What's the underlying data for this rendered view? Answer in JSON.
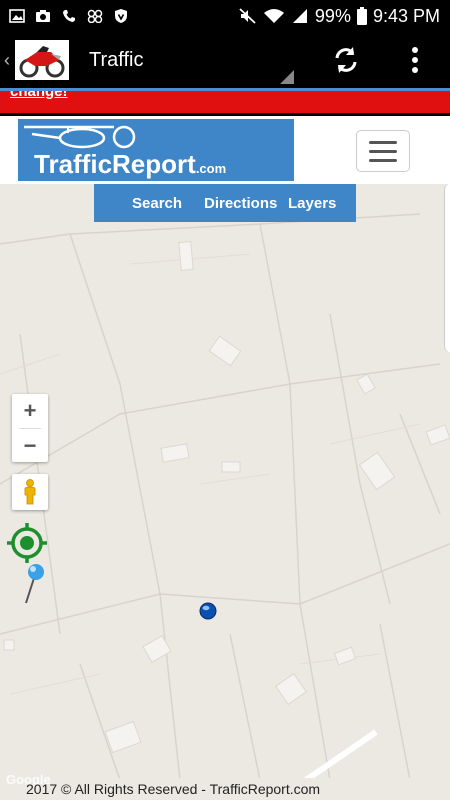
{
  "status_bar": {
    "battery": "99%",
    "time": "9:43 PM",
    "icons_left": [
      "picture-icon",
      "camera-icon",
      "phone-icon",
      "voicemail-icon",
      "shield-icon"
    ],
    "icons_right": [
      "mute-icon",
      "wifi-icon",
      "signal-icon",
      "battery-icon"
    ]
  },
  "app_bar": {
    "title": "Traffic",
    "logo_icon": "motorcycle-logo-icon",
    "actions": [
      "refresh-icon",
      "overflow-menu-icon"
    ]
  },
  "banner": {
    "link_text": "change!"
  },
  "site_header": {
    "logo_text": "TrafficReport",
    "logo_suffix": ".com"
  },
  "nav": {
    "items": [
      {
        "label": "Search"
      },
      {
        "label": "Directions"
      },
      {
        "label": "Layers"
      }
    ]
  },
  "map_controls": {
    "zoom_in": "+",
    "zoom_out": "−"
  },
  "footer": {
    "copyright": "2017 © All Rights Reserved - TrafficReport.com",
    "google_mark": "Google"
  },
  "colors": {
    "brand_blue": "#3f86c8",
    "banner_red": "#e11010",
    "map_bg": "#ece9e2",
    "locate_green": "#1f8f2e"
  }
}
